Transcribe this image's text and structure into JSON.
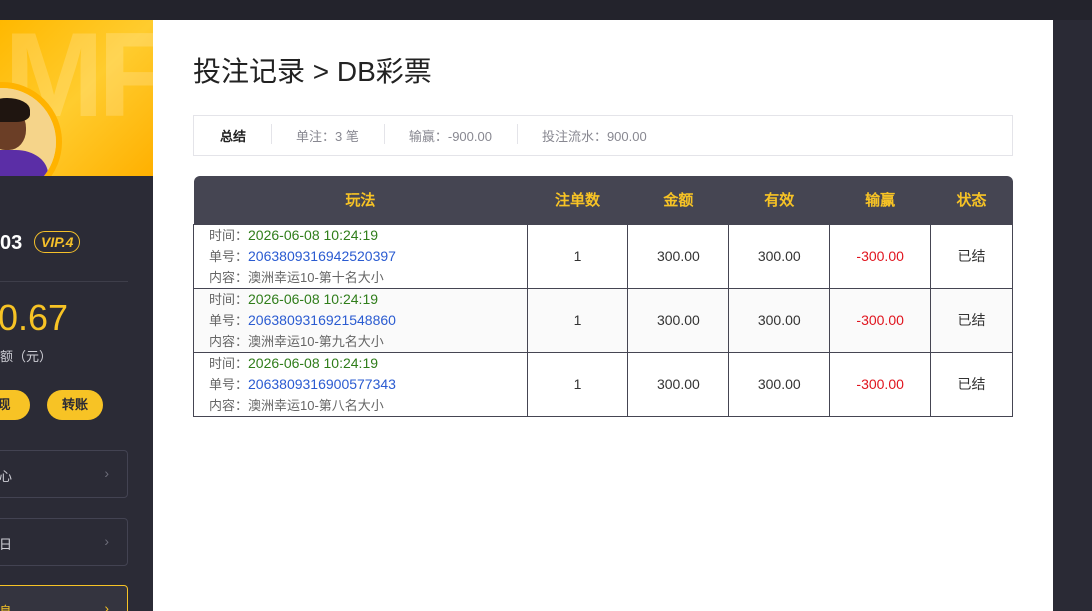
{
  "sidebar": {
    "username": "03",
    "vip": "VIP.4",
    "balance": "0.67",
    "balance_label": "额（元）",
    "btn_withdraw": "现",
    "btn_transfer": "转账",
    "menu": [
      {
        "label": "心"
      },
      {
        "label": "日"
      },
      {
        "label": "息"
      }
    ]
  },
  "page": {
    "title": "投注记录 > DB彩票"
  },
  "summary": {
    "label": "总结",
    "orders": "单注：3 笔",
    "profit": "输赢：-900.00",
    "turnover": "投注流水：900.00"
  },
  "table": {
    "headers": [
      "玩法",
      "注单数",
      "金额",
      "有效",
      "输赢",
      "状态"
    ],
    "time_key": "时间：",
    "order_key": "单号：",
    "content_key": "内容：",
    "rows": [
      {
        "time": "2026-06-08 10:24:19",
        "order": "2063809316942520397",
        "content": "澳洲幸运10-第十名大小",
        "count": "1",
        "amount": "300.00",
        "valid": "300.00",
        "profit": "-300.00",
        "status": "已结"
      },
      {
        "time": "2026-06-08 10:24:19",
        "order": "2063809316921548860",
        "content": "澳洲幸运10-第九名大小",
        "count": "1",
        "amount": "300.00",
        "valid": "300.00",
        "profit": "-300.00",
        "status": "已结"
      },
      {
        "time": "2026-06-08 10:24:19",
        "order": "2063809316900577343",
        "content": "澳洲幸运10-第八名大小",
        "count": "1",
        "amount": "300.00",
        "valid": "300.00",
        "profit": "-300.00",
        "status": "已结"
      }
    ]
  },
  "colors": {
    "accent": "#f7c325",
    "header_bg": "#454552",
    "negative": "#e0141e",
    "time": "#2f7d1a",
    "order": "#2a5bd1"
  }
}
